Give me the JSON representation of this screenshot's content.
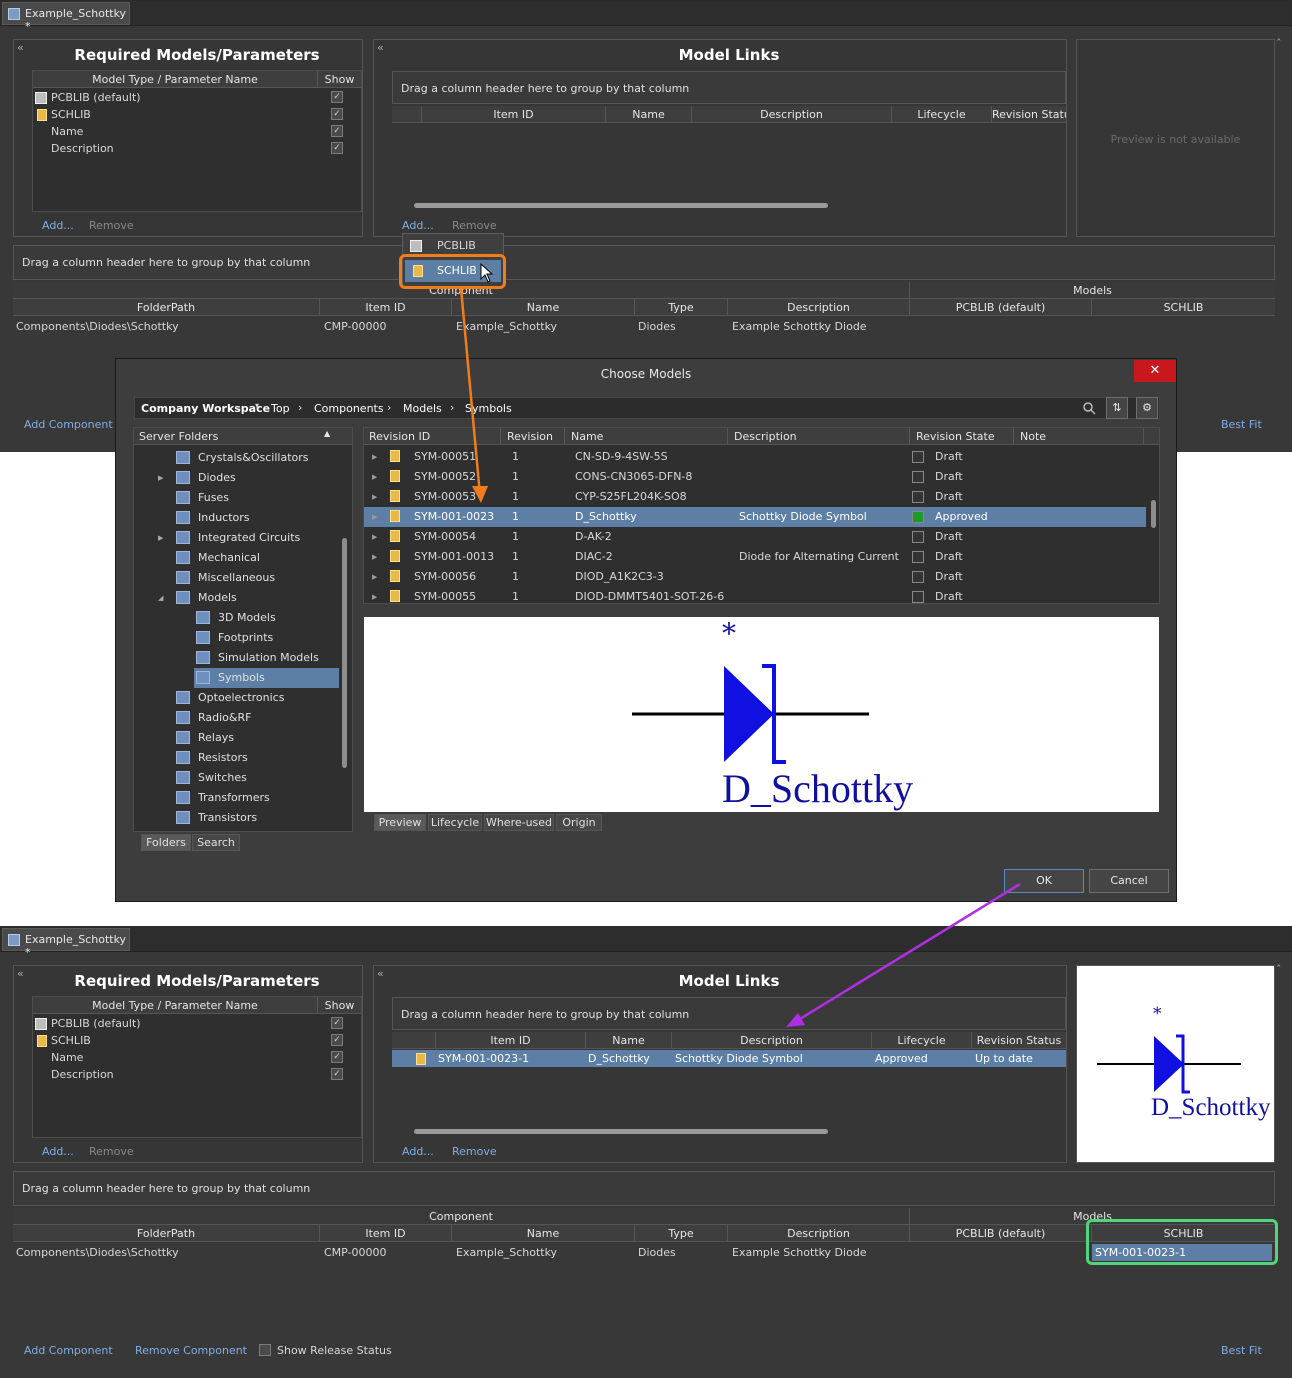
{
  "colors": {
    "accent": "#80aee6",
    "selection": "#5d7fa6",
    "orange": "#f07d1b",
    "purple": "#b02fe6",
    "green": "#52d47a",
    "approved": "#1d9a2a",
    "diode": "#1010e0"
  },
  "top": {
    "tab_title": "Example_Schottky *",
    "req": {
      "title": "Required Models/Parameters",
      "col_type": "Model Type / Parameter Name",
      "col_show": "Show",
      "rows": [
        "PCBLIB (default)",
        "SCHLIB",
        "Name",
        "Description"
      ],
      "add": "Add...",
      "remove": "Remove"
    },
    "links": {
      "title": "Model Links",
      "drag_hint": "Drag a column header here to group by that column",
      "cols": [
        "Item ID",
        "Name",
        "Description",
        "Lifecycle",
        "Revision Status"
      ],
      "add": "Add...",
      "remove": "Remove"
    },
    "preview_text": "Preview is not available",
    "menu": {
      "pcblib": "PCBLIB",
      "schlib": "SCHLIB"
    },
    "comp": {
      "drag_hint": "Drag a column header here to group by that column",
      "group_component": "Component",
      "group_models": "Models",
      "cols": [
        "FolderPath",
        "Item ID",
        "Name",
        "Type",
        "Description",
        "PCBLIB (default)",
        "SCHLIB"
      ],
      "row": [
        "Components\\Diodes\\Schottky",
        "CMP-00000",
        "Example_Schottky",
        "Diodes",
        "Example Schottky Diode",
        "",
        ""
      ],
      "add_component": "Add Component",
      "best_fit": "Best Fit"
    }
  },
  "dialog": {
    "title": "Choose Models",
    "close": "✕",
    "breadcrumb": [
      "Company Workspace",
      "Top",
      "Components",
      "Models",
      "Symbols"
    ],
    "tree_header": "Server Folders",
    "tree": [
      "Crystals&Oscillators",
      "Diodes",
      "Fuses",
      "Inductors",
      "Integrated Circuits",
      "Mechanical",
      "Miscellaneous",
      "Models",
      "3D Models",
      "Footprints",
      "Simulation Models",
      "Symbols",
      "Optoelectronics",
      "Radio&RF",
      "Relays",
      "Resistors",
      "Switches",
      "Transformers",
      "Transistors"
    ],
    "tree_tabs": [
      "Folders",
      "Search"
    ],
    "cols": [
      "Revision ID",
      "Revision",
      "Name",
      "Description",
      "Revision State",
      "Note"
    ],
    "rows": [
      [
        "SYM-00051",
        "1",
        "CN-SD-9-4SW-5S",
        "",
        "Draft"
      ],
      [
        "SYM-00052",
        "1",
        "CONS-CN3065-DFN-8",
        "",
        "Draft"
      ],
      [
        "SYM-00053",
        "1",
        "CYP-S25FL204K-SO8",
        "",
        "Draft"
      ],
      [
        "SYM-001-0023",
        "1",
        "D_Schottky",
        "Schottky Diode Symbol",
        "Approved"
      ],
      [
        "SYM-00054",
        "1",
        "D-AK-2",
        "",
        "Draft"
      ],
      [
        "SYM-001-0013",
        "1",
        "DIAC-2",
        "Diode for Alternating Current",
        "Draft"
      ],
      [
        "SYM-00056",
        "1",
        "DIOD_A1K2C3-3",
        "",
        "Draft"
      ],
      [
        "SYM-00055",
        "1",
        "DIOD-DMMT5401-SOT-26-6",
        "",
        "Draft"
      ]
    ],
    "preview_star": "*",
    "preview_name": "D_Schottky",
    "preview_tabs": [
      "Preview",
      "Lifecycle",
      "Where-used",
      "Origin"
    ],
    "ok": "OK",
    "cancel": "Cancel"
  },
  "bottom": {
    "tab_title": "Example_Schottky *",
    "req": {
      "title": "Required Models/Parameters",
      "col_type": "Model Type / Parameter Name",
      "col_show": "Show",
      "rows": [
        "PCBLIB (default)",
        "SCHLIB",
        "Name",
        "Description"
      ],
      "add": "Add...",
      "remove": "Remove"
    },
    "links": {
      "title": "Model Links",
      "drag_hint": "Drag a column header here to group by that column",
      "cols": [
        "Item ID",
        "Name",
        "Description",
        "Lifecycle",
        "Revision Status"
      ],
      "row": [
        "SYM-001-0023-1",
        "D_Schottky",
        "Schottky Diode Symbol",
        "Approved",
        "Up to date"
      ],
      "add": "Add...",
      "remove": "Remove"
    },
    "preview_star": "*",
    "preview_name": "D_Schottky",
    "comp": {
      "drag_hint": "Drag a column header here to group by that column",
      "group_component": "Component",
      "group_models": "Models",
      "cols": [
        "FolderPath",
        "Item ID",
        "Name",
        "Type",
        "Description",
        "PCBLIB (default)",
        "SCHLIB"
      ],
      "row": [
        "Components\\Diodes\\Schottky",
        "CMP-00000",
        "Example_Schottky",
        "Diodes",
        "Example Schottky Diode",
        "",
        "SYM-001-0023-1"
      ],
      "add_component": "Add Component",
      "remove_component": "Remove Component",
      "show_release": "Show Release Status",
      "best_fit": "Best Fit"
    }
  }
}
